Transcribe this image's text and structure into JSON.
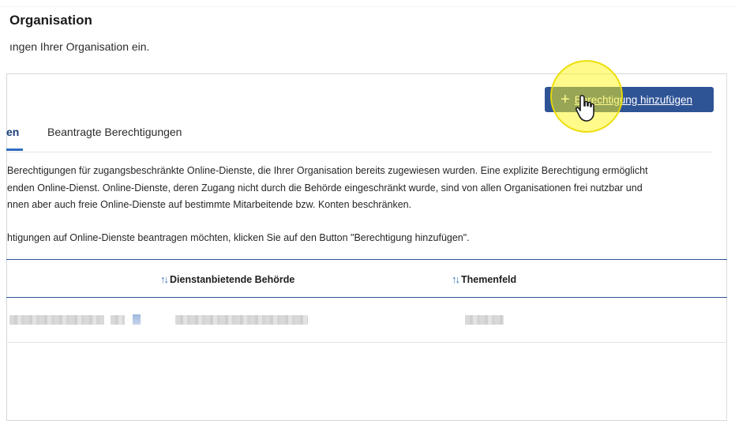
{
  "header": {
    "title": "Organisation",
    "subtitle": "ıngen Ihrer Organisation ein."
  },
  "toolbar": {
    "add_button_label": "Berechtigung hinzufügen",
    "add_button_icon": "plus-icon"
  },
  "tabs": [
    {
      "label": "en",
      "active": true
    },
    {
      "label": "Beantragte Berechtigungen",
      "active": false
    }
  ],
  "description": {
    "paragraph1_lines": [
      "Berechtigungen für zugangsbeschränkte Online-Dienste, die Ihrer Organisation bereits zugewiesen wurden. Eine explizite Berechtigung ermöglicht",
      "enden Online-Dienst. Online-Dienste, deren Zugang nicht durch die Behörde eingeschränkt wurde, sind von allen Organisationen frei nutzbar und",
      "nnen aber auch freie Online-Dienste auf bestimmte Mitarbeitende bzw. Konten beschränken."
    ],
    "paragraph2": "htigungen auf Online-Dienste beantragen möchten, klicken Sie auf den Button \"Berechtigung hinzufügen\"."
  },
  "table": {
    "columns": [
      {
        "label": "Dienstanbietende Behörde",
        "sort_icon": "sort-icon"
      },
      {
        "label": "Themenfeld",
        "sort_icon": "sort-icon"
      }
    ]
  },
  "colors": {
    "primary": "#2f5496",
    "tab_active": "#2f6ec2",
    "highlight": "#fff514"
  }
}
